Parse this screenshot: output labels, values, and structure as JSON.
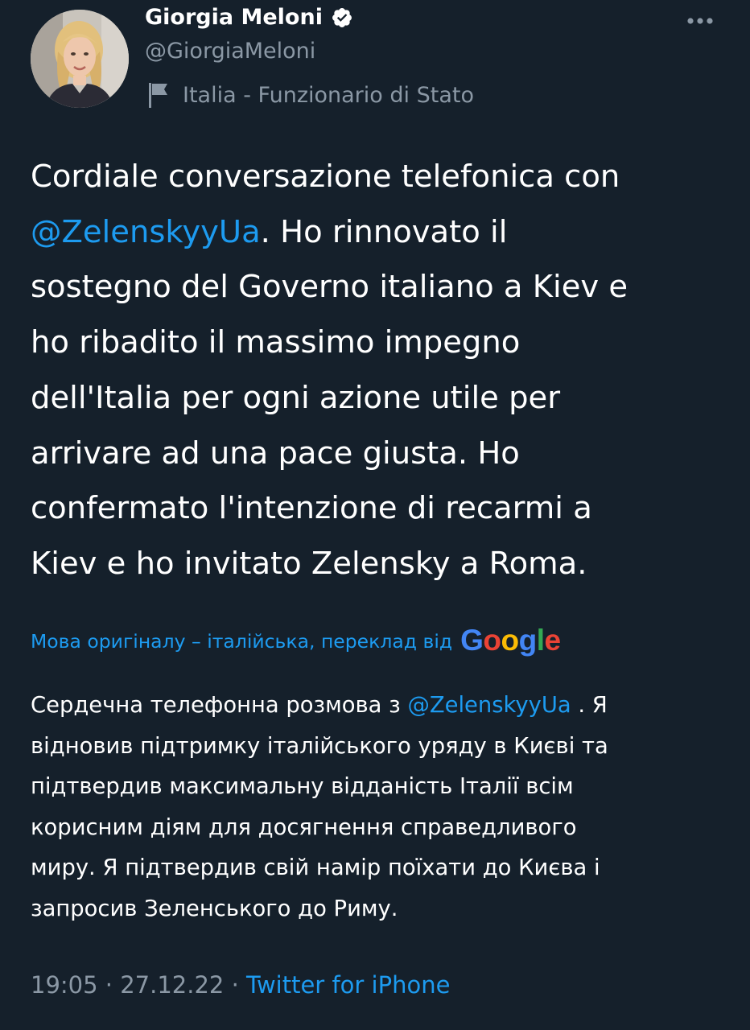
{
  "author": {
    "name": "Giorgia Meloni",
    "handle": "@GiorgiaMeloni",
    "affiliation": "Italia - Funzionario di Stato",
    "verified_color": "#ffffff"
  },
  "icons": {
    "verified": "verified-badge-icon",
    "affiliation": "flag-icon",
    "more": "more-options-icon"
  },
  "tweet": {
    "lines": [
      [
        {
          "text": "Cordiale conversazione telefonica con"
        }
      ],
      [
        {
          "text": "@ZelenskyyUa",
          "mention": true
        },
        {
          "text": ". Ho rinnovato il"
        }
      ],
      [
        {
          "text": "sostegno del Governo italiano a Kiev e"
        }
      ],
      [
        {
          "text": "ho ribadito il massimo impegno"
        }
      ],
      [
        {
          "text": "dell'Italia per ogni azione utile per"
        }
      ],
      [
        {
          "text": "arrivare ad una pace giusta. Ho"
        }
      ],
      [
        {
          "text": "confermato l'intenzione di recarmi a"
        }
      ],
      [
        {
          "text": "Kiev e ho invitato Zelensky a Roma."
        }
      ]
    ]
  },
  "translation": {
    "attribution": "Мова оригіналу – італійська, переклад від",
    "provider": "Google",
    "lines": [
      [
        {
          "text": "Сердечна телефонна розмова з "
        },
        {
          "text": "@ZelenskyyUa",
          "mention": true
        },
        {
          "text": " . Я"
        }
      ],
      [
        {
          "text": "відновив підтримку італійського уряду в Києві та"
        }
      ],
      [
        {
          "text": "підтвердив максимальну відданість Італії всім"
        }
      ],
      [
        {
          "text": "корисним діям для досягнення справедливого"
        }
      ],
      [
        {
          "text": "миру. Я підтвердив свій намір поїхати до Києва і"
        }
      ],
      [
        {
          "text": "запросив Зеленського до Риму."
        }
      ]
    ]
  },
  "meta": {
    "time": "19:05",
    "separator": " · ",
    "date": "27.12.22",
    "source": "Twitter for iPhone"
  },
  "colors": {
    "background": "#15202b",
    "text": "#ffffff",
    "secondary": "#8b98a5",
    "accent": "#1d9bf0"
  }
}
